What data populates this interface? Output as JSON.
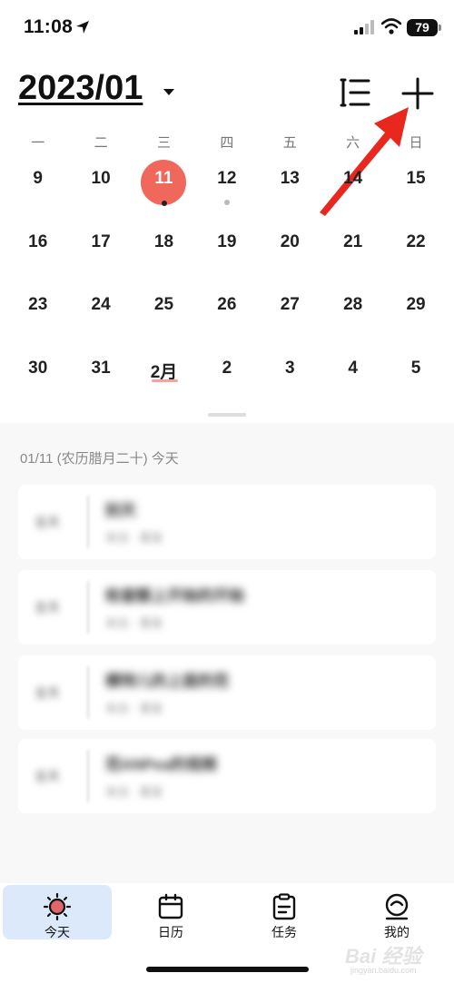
{
  "status_bar": {
    "time": "11:08",
    "battery": "79"
  },
  "header": {
    "month": "2023/01"
  },
  "weekdays": [
    "一",
    "二",
    "三",
    "四",
    "五",
    "六",
    "日"
  ],
  "weeks": [
    [
      "9",
      "10",
      "11",
      "12",
      "13",
      "14",
      "15"
    ],
    [
      "16",
      "17",
      "18",
      "19",
      "20",
      "21",
      "22"
    ],
    [
      "23",
      "24",
      "25",
      "26",
      "27",
      "28",
      "29"
    ],
    [
      "30",
      "31",
      "2月",
      "2",
      "3",
      "4",
      "5"
    ]
  ],
  "agenda": {
    "date_label": "01/11 (农历腊月二十) 今天",
    "events": [
      {
        "time": "全天",
        "title": "别天",
        "subtitle": "来自 · 重复"
      },
      {
        "time": "全天",
        "title": "检查额上开始的开始",
        "subtitle": "来自 · 重复"
      },
      {
        "time": "全天",
        "title": "模特儿的上面的范",
        "subtitle": "来自 · 重复"
      },
      {
        "time": "全天",
        "title": "范ANPea的视频",
        "subtitle": "来自 · 重复"
      }
    ]
  },
  "tabs": [
    {
      "label": "今天",
      "icon": "sun-icon"
    },
    {
      "label": "日历",
      "icon": "calendar-icon"
    },
    {
      "label": "任务",
      "icon": "clipboard-icon"
    },
    {
      "label": "我的",
      "icon": "profile-icon"
    }
  ],
  "watermark": {
    "text": "Bai 经验",
    "sub": "jingyan.baidu.com"
  },
  "colors": {
    "accent": "#f0675c",
    "arrow": "#e8281f",
    "active_tab": "#dbe9fb"
  }
}
